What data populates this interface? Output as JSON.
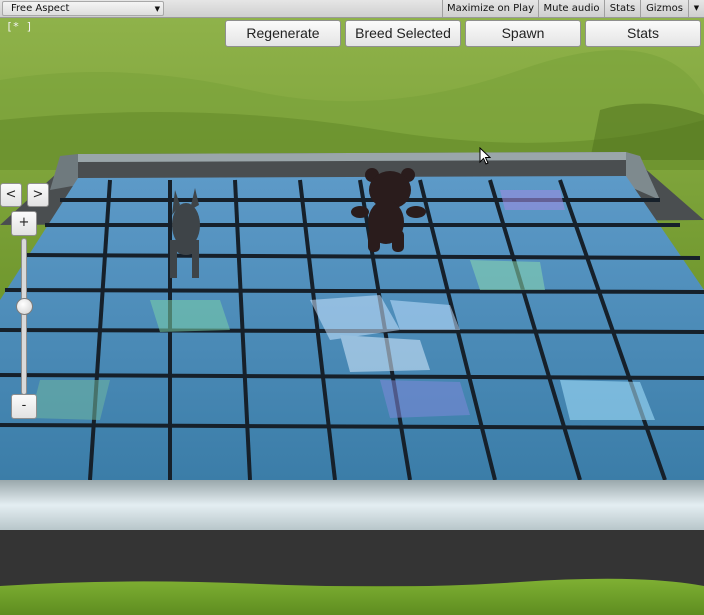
{
  "toolbar": {
    "aspect": "Free Aspect",
    "maximize": "Maximize on Play",
    "mute": "Mute audio",
    "stats": "Stats",
    "gizmos": "Gizmos"
  },
  "hud": {
    "fps": "[*     ]"
  },
  "buttons": {
    "regenerate": "Regenerate",
    "breed": "Breed Selected",
    "spawn": "Spawn",
    "stats": "Stats"
  },
  "nav": {
    "prev": "<",
    "next": ">"
  },
  "zoom": {
    "plus": "+",
    "minus": "-",
    "level": 0.43
  },
  "colors": {
    "grass": "#6f962e",
    "tile_border": "#16202a",
    "tile_blue": "#4a8fc4",
    "tile_green": "#5fa58a",
    "wall": "#8a9a9e"
  }
}
